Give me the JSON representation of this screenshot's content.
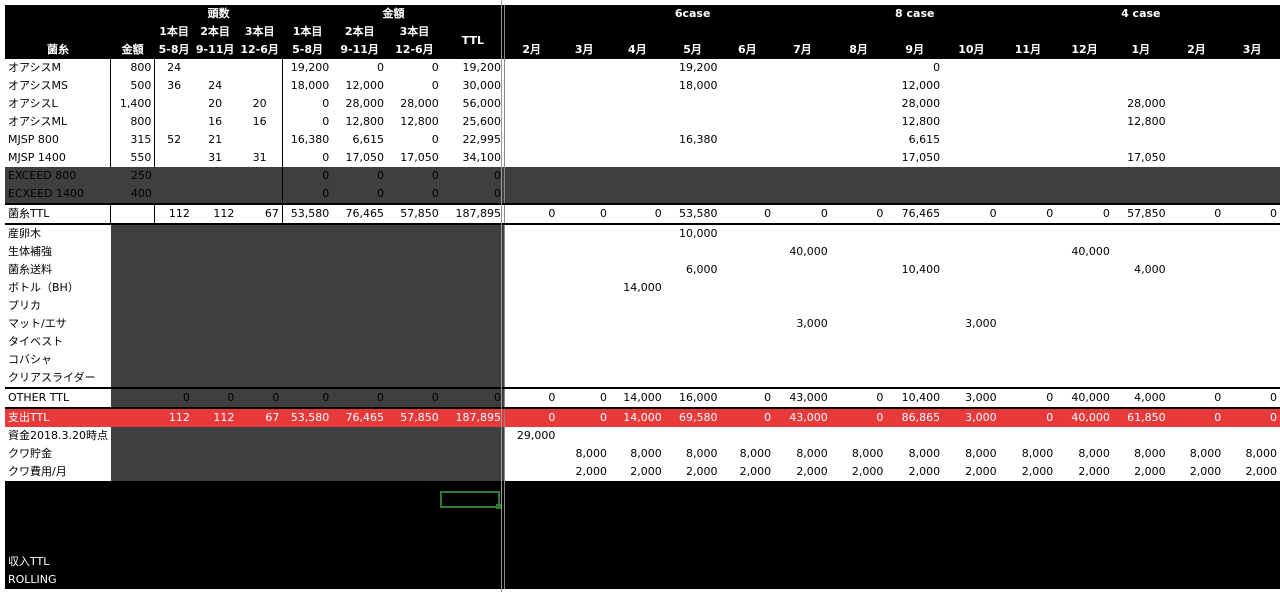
{
  "header": {
    "group1": "頭数",
    "group2": "金額",
    "case6": "6case",
    "case8": "8 case",
    "case4": "4 case",
    "sub1": "1本目",
    "sub2": "2本目",
    "sub3": "3本目",
    "ttl": "TTL",
    "p1": "5-8月",
    "p2": "9-11月",
    "p3": "12-6月",
    "label": "菌糸",
    "price": "金額",
    "months": [
      "2月",
      "3月",
      "4月",
      "5月",
      "6月",
      "7月",
      "8月",
      "9月",
      "10月",
      "11月",
      "12月",
      "1月",
      "2月",
      "3月"
    ]
  },
  "products": [
    {
      "name": "オアシスM",
      "price": "800",
      "h": [
        "24",
        "",
        ""
      ],
      "a": [
        "19,200",
        "0",
        "0"
      ],
      "ttl": "19,200",
      "m": [
        "",
        "",
        "",
        "19,200",
        "",
        "",
        "",
        "0",
        "",
        "",
        "",
        "",
        "",
        ""
      ]
    },
    {
      "name": "オアシスMS",
      "price": "500",
      "h": [
        "36",
        "24",
        ""
      ],
      "a": [
        "18,000",
        "12,000",
        "0"
      ],
      "ttl": "30,000",
      "m": [
        "",
        "",
        "",
        "18,000",
        "",
        "",
        "",
        "12,000",
        "",
        "",
        "",
        "",
        "",
        ""
      ]
    },
    {
      "name": "オアシスL",
      "price": "1,400",
      "h": [
        "",
        "20",
        "20"
      ],
      "a": [
        "0",
        "28,000",
        "28,000"
      ],
      "ttl": "56,000",
      "m": [
        "",
        "",
        "",
        "",
        "",
        "",
        "",
        "28,000",
        "",
        "",
        "",
        "28,000",
        "",
        ""
      ]
    },
    {
      "name": "オアシスML",
      "price": "800",
      "h": [
        "",
        "16",
        "16"
      ],
      "a": [
        "0",
        "12,800",
        "12,800"
      ],
      "ttl": "25,600",
      "m": [
        "",
        "",
        "",
        "",
        "",
        "",
        "",
        "12,800",
        "",
        "",
        "",
        "12,800",
        "",
        ""
      ]
    },
    {
      "name": "MJSP 800",
      "price": "315",
      "h": [
        "52",
        "21",
        ""
      ],
      "a": [
        "16,380",
        "6,615",
        "0"
      ],
      "ttl": "22,995",
      "m": [
        "",
        "",
        "",
        "16,380",
        "",
        "",
        "",
        "6,615",
        "",
        "",
        "",
        "",
        "",
        ""
      ]
    },
    {
      "name": "MJSP 1400",
      "price": "550",
      "h": [
        "",
        "31",
        "31"
      ],
      "a": [
        "0",
        "17,050",
        "17,050"
      ],
      "ttl": "34,100",
      "m": [
        "",
        "",
        "",
        "",
        "",
        "",
        "",
        "17,050",
        "",
        "",
        "",
        "17,050",
        "",
        ""
      ]
    }
  ],
  "exceed": [
    {
      "name": "EXCEED 800",
      "price": "250",
      "a": [
        "0",
        "0",
        "0"
      ],
      "ttl": "0"
    },
    {
      "name": "ECXEED 1400",
      "price": "400",
      "a": [
        "0",
        "0",
        "0"
      ],
      "ttl": "0"
    }
  ],
  "kinshi_ttl": {
    "name": "菌糸TTL",
    "h": [
      "112",
      "112",
      "67"
    ],
    "a": [
      "53,580",
      "76,465",
      "57,850"
    ],
    "ttl": "187,895",
    "m": [
      "0",
      "0",
      "0",
      "53,580",
      "0",
      "0",
      "0",
      "76,465",
      "0",
      "0",
      "0",
      "57,850",
      "0",
      "0"
    ]
  },
  "others": [
    {
      "name": "産卵木",
      "m": [
        "",
        "",
        "",
        "10,000",
        "",
        "",
        "",
        "",
        "",
        "",
        "",
        "",
        "",
        ""
      ]
    },
    {
      "name": "生体補強",
      "m": [
        "",
        "",
        "",
        "",
        "",
        "40,000",
        "",
        "",
        "",
        "",
        "40,000",
        "",
        "",
        ""
      ]
    },
    {
      "name": "菌糸送料",
      "m": [
        "",
        "",
        "",
        "6,000",
        "",
        "",
        "",
        "10,400",
        "",
        "",
        "",
        "4,000",
        "",
        ""
      ]
    },
    {
      "name": "ボトル（BH）",
      "m": [
        "",
        "",
        "14,000",
        "",
        "",
        "",
        "",
        "",
        "",
        "",
        "",
        "",
        "",
        ""
      ]
    },
    {
      "name": "プリカ",
      "m": [
        "",
        "",
        "",
        "",
        "",
        "",
        "",
        "",
        "",
        "",
        "",
        "",
        "",
        ""
      ]
    },
    {
      "name": "マット/エサ",
      "m": [
        "",
        "",
        "",
        "",
        "",
        "3,000",
        "",
        "",
        "3,000",
        "",
        "",
        "",
        "",
        ""
      ]
    },
    {
      "name": "タイベスト",
      "m": [
        "",
        "",
        "",
        "",
        "",
        "",
        "",
        "",
        "",
        "",
        "",
        "",
        "",
        ""
      ]
    },
    {
      "name": "コバシャ",
      "m": [
        "",
        "",
        "",
        "",
        "",
        "",
        "",
        "",
        "",
        "",
        "",
        "",
        "",
        ""
      ]
    },
    {
      "name": "クリアスライダー",
      "m": [
        "",
        "",
        "",
        "",
        "",
        "",
        "",
        "",
        "",
        "",
        "",
        "",
        "",
        ""
      ]
    }
  ],
  "other_ttl": {
    "name": "OTHER TTL",
    "h": [
      "0",
      "0",
      "0"
    ],
    "a": [
      "0",
      "0",
      "0"
    ],
    "ttl": "0",
    "m": [
      "0",
      "0",
      "14,000",
      "16,000",
      "0",
      "43,000",
      "0",
      "10,400",
      "3,000",
      "0",
      "40,000",
      "4,000",
      "0",
      "0"
    ]
  },
  "shishutsu_ttl": {
    "name": "支出TTL",
    "h": [
      "112",
      "112",
      "67"
    ],
    "a": [
      "53,580",
      "76,465",
      "57,850"
    ],
    "ttl": "187,895",
    "m": [
      "0",
      "0",
      "14,000",
      "69,580",
      "0",
      "43,000",
      "0",
      "86,865",
      "3,000",
      "0",
      "40,000",
      "61,850",
      "0",
      "0"
    ]
  },
  "extra": [
    {
      "name": "資金2018.3.20時点",
      "m": [
        "29,000",
        "",
        "",
        "",
        "",
        "",
        "",
        "",
        "",
        "",
        "",
        "",
        "",
        ""
      ]
    },
    {
      "name": "クワ貯金",
      "m": [
        "",
        "8,000",
        "8,000",
        "8,000",
        "8,000",
        "8,000",
        "8,000",
        "8,000",
        "8,000",
        "8,000",
        "8,000",
        "8,000",
        "8,000",
        "8,000"
      ]
    },
    {
      "name": "クワ費用/月",
      "m": [
        "",
        "2,000",
        "2,000",
        "2,000",
        "2,000",
        "2,000",
        "2,000",
        "2,000",
        "2,000",
        "2,000",
        "2,000",
        "2,000",
        "2,000",
        "2,000"
      ]
    }
  ],
  "bottom": {
    "income": "収入TTL",
    "rolling": "ROLLING"
  }
}
